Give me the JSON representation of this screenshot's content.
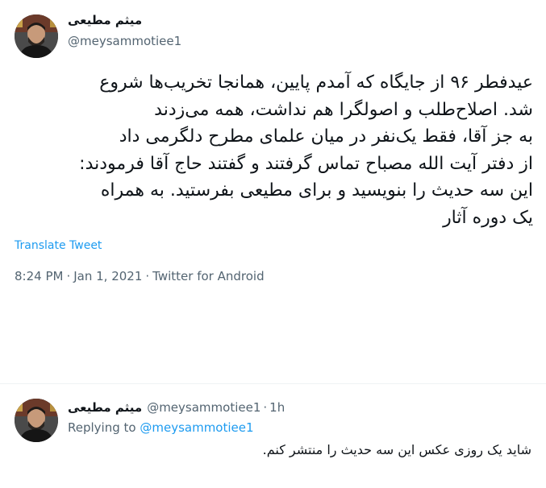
{
  "main_tweet": {
    "display_name": "میثم مطیعی",
    "handle": "@meysammotiee1",
    "text": "عیدفطر ۹۶ از جایگاه که آمدم پایین، همانجا تخریب‌ها شروع\nشد. اصلاح‌طلب و اصولگرا هم نداشت، همه می‌زدند\nبه جز آقا، فقط یک‌نفر در میان علمای مطرح دلگرمی داد\nاز دفتر آیت الله مصباح تماس گرفتند و گفتند حاج آقا فرمودند:\nاین سه حدیث را بنویسید و برای مطیعی بفرستید. به همراه\nیک دوره آثار",
    "translate_label": "Translate Tweet",
    "time": "8:24 PM",
    "date": "Jan 1, 2021",
    "source": "Twitter for Android",
    "separator": "·"
  },
  "reply_tweet": {
    "display_name": "میثم مطیعی",
    "handle": "@meysammotiee1",
    "separator": "·",
    "relative_time": "1h",
    "replying_label": "Replying to",
    "replying_handle": "@meysammotiee1",
    "text": "شاید یک روزی عکس این سه حدیث را منتشر کنم."
  },
  "colors": {
    "link": "#1d9bf0",
    "secondary_text": "#536471",
    "primary_text": "#0f1419",
    "divider": "#eff3f4"
  },
  "icons": {
    "avatar": "profile-photo"
  }
}
